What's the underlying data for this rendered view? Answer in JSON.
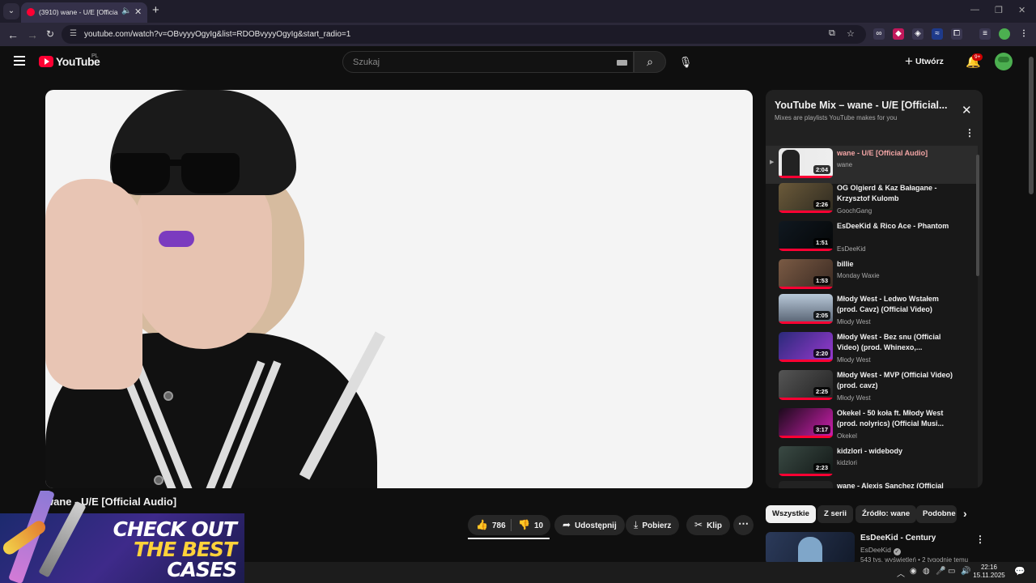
{
  "browser": {
    "tab_title": "(3910) wane - U/E [Official",
    "url": "youtube.com/watch?v=OBvyyyOgyIg&list=RDOBvyyyOgyIg&start_radio=1"
  },
  "masthead": {
    "logo_text": "YouTube",
    "country_code": "PL",
    "search_placeholder": "Szukaj",
    "create_label": "Utwórz",
    "notification_count": "9+"
  },
  "video": {
    "title": "wane - U/E [Official Audio]",
    "like_count": "786",
    "dislike_count": "10",
    "share_label": "Udostępnij",
    "download_label": "Pobierz",
    "clip_label": "Klip"
  },
  "ad": {
    "line1": "CHECK OUT",
    "line2": "THE BEST",
    "line3": "CASES"
  },
  "playlist": {
    "title": "YouTube Mix – wane - U/E [Official...",
    "subtitle": "Mixes are playlists YouTube makes for you",
    "items": [
      {
        "title": "wane - U/E [Official Audio]",
        "channel": "wane",
        "duration": "2:04",
        "active": true
      },
      {
        "title": "OG Olgierd & Kaz Bałagane - Krzysztof Kulomb",
        "channel": "GoochGang",
        "duration": "2:26"
      },
      {
        "title": "EsDeeKid & Rico Ace - Phantom",
        "channel": "EsDeeKid",
        "duration": "1:51"
      },
      {
        "title": "billie",
        "channel": "Monday Waxie",
        "duration": "1:53"
      },
      {
        "title": "Młody West - Ledwo Wstałem (prod. Cavz) (Official Video)",
        "channel": "Młody West",
        "duration": "2:05"
      },
      {
        "title": "Młody West - Bez snu (Official Video) (prod. Whinexo,...",
        "channel": "Młody West",
        "duration": "2:20"
      },
      {
        "title": "Młody West - MVP (Official Video) (prod. cavz)",
        "channel": "Młody West",
        "duration": "2:25"
      },
      {
        "title": "Okekel - 50 koła ft. Młody West (prod. nolyrics) (Official Musi...",
        "channel": "Okekel",
        "duration": "3:17"
      },
      {
        "title": "kidzlori - widebody",
        "channel": "kidzlori",
        "duration": "2:23"
      },
      {
        "title": "wane - Alexis Sanchez (Official",
        "channel": "",
        "duration": ""
      }
    ]
  },
  "chips": [
    "Wszystkie",
    "Z serii",
    "Źródło: wane",
    "Podobne"
  ],
  "recommendation": {
    "title": "EsDeeKid - Century",
    "channel": "EsDeeKid",
    "meta": "543 tys. wyświetleń • 2 tygodnie temu"
  },
  "taskbar": {
    "time": "22:16",
    "date": "15.11.2025"
  }
}
